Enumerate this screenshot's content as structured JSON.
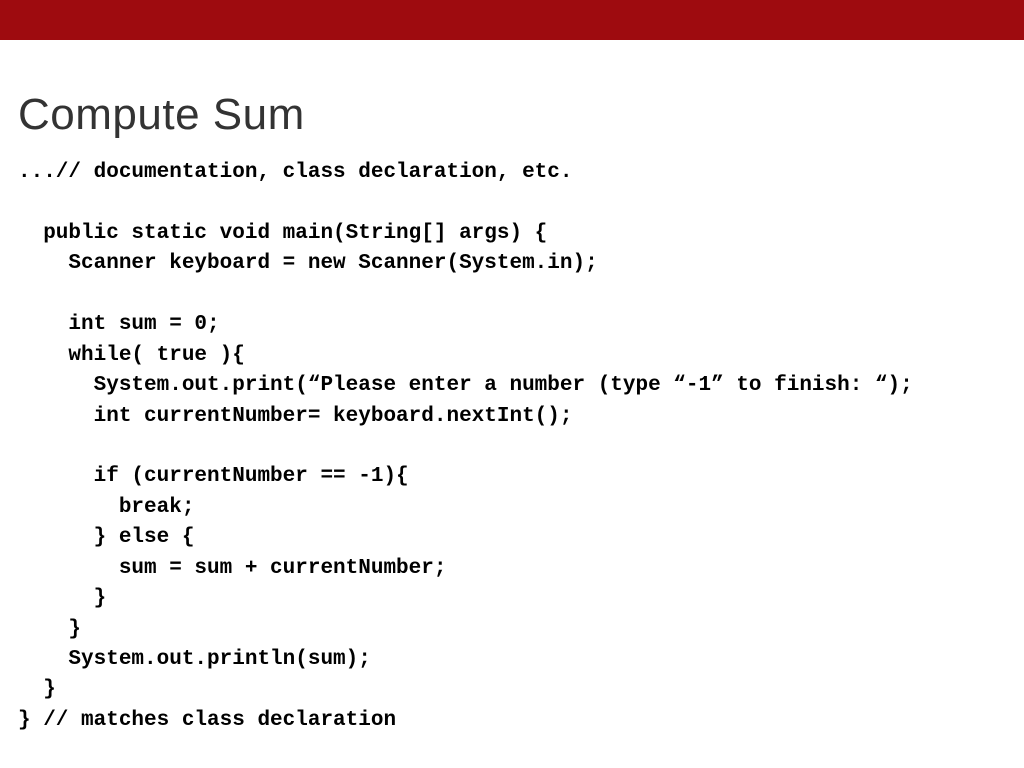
{
  "slide": {
    "title": "Compute Sum",
    "code": "...// documentation, class declaration, etc.\n\n  public static void main(String[] args) {\n    Scanner keyboard = new Scanner(System.in);\n\n    int sum = 0;\n    while( true ){\n      System.out.print(“Please enter a number (type “-1” to finish: “);\n      int currentNumber= keyboard.nextInt();\n\n      if (currentNumber == -1){\n        break;\n      } else {\n        sum = sum + currentNumber;\n      }\n    }\n    System.out.println(sum);\n  }\n} // matches class declaration"
  }
}
